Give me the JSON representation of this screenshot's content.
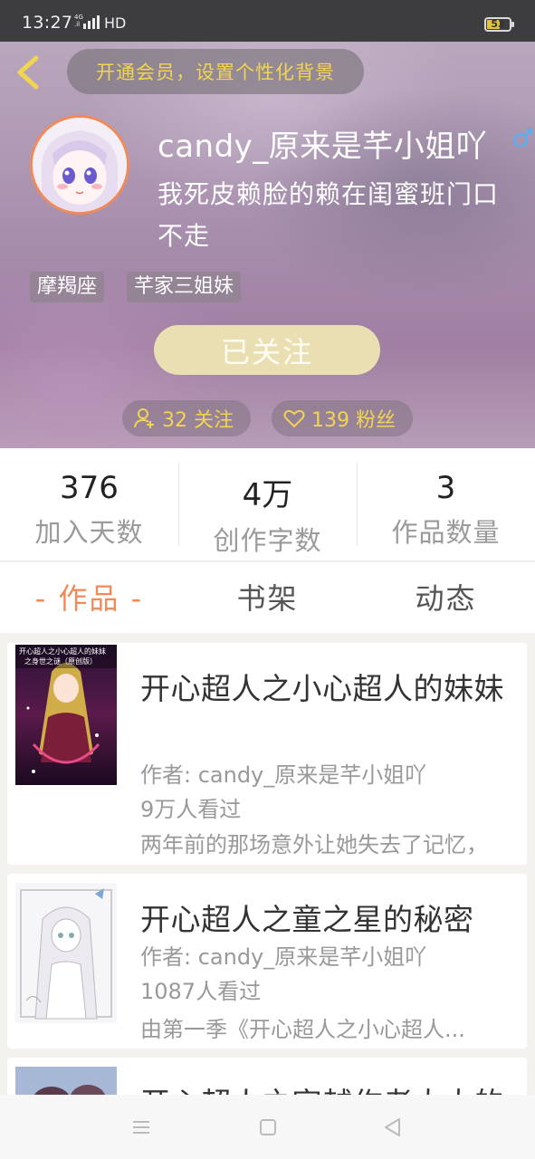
{
  "status_bar": {
    "time": "13:27",
    "network": "HD",
    "battery": "53"
  },
  "header": {
    "vip_prompt": "开通会员，设置个性化背景",
    "username": "candy_原来是芊小姐吖",
    "gender_symbol": "♂",
    "bio": "我死皮赖脸的赖在闺蜜班门口不走",
    "tags": [
      "摩羯座",
      "芊家三姐妹"
    ],
    "follow_button": "已关注",
    "following": "32 关注",
    "fans": "139 粉丝"
  },
  "stats": [
    {
      "value": "376",
      "label": "加入天数"
    },
    {
      "value": "4万",
      "label": "创作字数"
    },
    {
      "value": "3",
      "label": "作品数量"
    }
  ],
  "tabs": [
    {
      "label": "- 作品 -",
      "active": true
    },
    {
      "label": "书架",
      "active": false
    },
    {
      "label": "动态",
      "active": false
    }
  ],
  "books": [
    {
      "title": "开心超人之小心超人的妹妹",
      "author": "作者: candy_原来是芊小姐吖",
      "views": "9万人看过",
      "desc": "两年前的那场意外让她失去了记忆，",
      "cover_text": "开心超人之小心超人的妹妹之身世之谜（原创版）"
    },
    {
      "title": "开心超人之童之星的秘密",
      "author": "作者: candy_原来是芊小姐吖",
      "views": "1087人看过",
      "desc": "由第一季《开心超人之小心超人..."
    },
    {
      "title": "开心超人之穿越作者大大的"
    }
  ],
  "colors": {
    "accent": "#f08a5a",
    "gold": "#f2d453",
    "follow_bg": "#eadfb2"
  }
}
